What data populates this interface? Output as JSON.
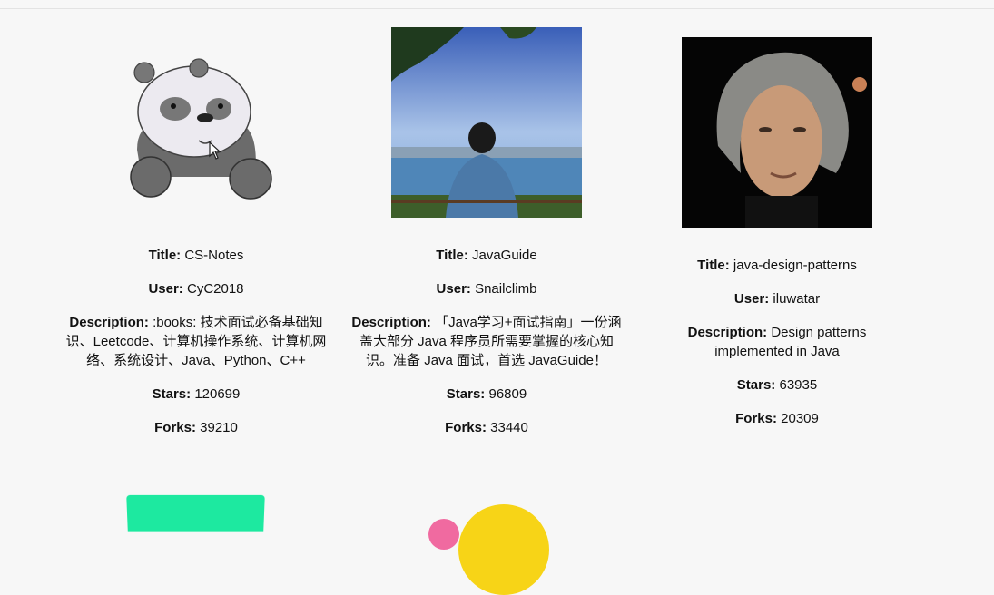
{
  "cards": [
    {
      "avatar_icon": "panda-avatar-icon",
      "title_label": "Title:",
      "title": "CS-Notes",
      "user_label": "User:",
      "user": "CyC2018",
      "description_label": "Description:",
      "description": ":books: 技术面试必备基础知识、Leetcode、计算机操作系统、计算机网络、系统设计、Java、Python、C++",
      "stars_label": "Stars:",
      "stars": "120699",
      "forks_label": "Forks:",
      "forks": "39210"
    },
    {
      "avatar_icon": "seaside-photo-avatar",
      "title_label": "Title:",
      "title": "JavaGuide",
      "user_label": "User:",
      "user": "Snailclimb",
      "description_label": "Description:",
      "description": "「Java学习+面试指南」一份涵盖大部分 Java 程序员所需要掌握的核心知识。准备 Java 面试，首选 JavaGuide！",
      "stars_label": "Stars:",
      "stars": "96809",
      "forks_label": "Forks:",
      "forks": "33440"
    },
    {
      "avatar_icon": "portrait-photo-avatar",
      "title_label": "Title:",
      "title": "java-design-patterns",
      "user_label": "User:",
      "user": "iluwatar",
      "description_label": "Description:",
      "description": "Design patterns implemented in Java",
      "stars_label": "Stars:",
      "stars": "63935",
      "forks_label": "Forks:",
      "forks": "20309"
    }
  ],
  "colors": {
    "background": "#f7f7f7",
    "next_card_1_accent": "#1de9a0",
    "next_card_2_accent": "#f7d417",
    "next_card_2_secondary": "#f06aa0"
  }
}
